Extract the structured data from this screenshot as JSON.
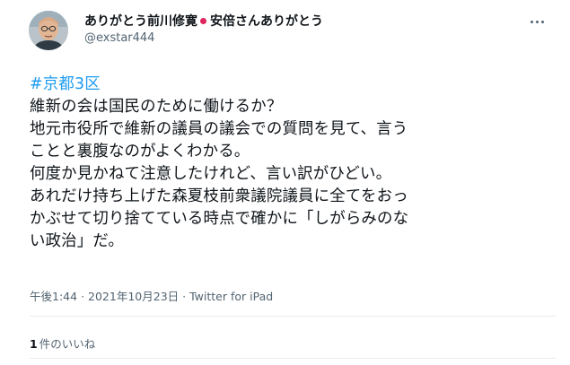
{
  "author": {
    "display_name_part1": "ありがとう前川修寛",
    "display_name_part2": "安倍さんありがとう",
    "handle": "@exstar444"
  },
  "tweet": {
    "hashtag": "#京都3区",
    "lines": [
      "維新の会は国民のために働けるか？",
      "地元市役所で維新の議員の議会での質問を見て、言う",
      "ことと裏腹なのがよくわかる。",
      "何度か見かねて注意したけれど、言い訳がひどい。",
      "あれだけ持ち上げた森夏枝前衆議院議員に全てをおっ",
      "かぶせて切り捨てている時点で確かに「しがらみのな",
      "い政治」だ。"
    ]
  },
  "meta": {
    "time": "午後1:44",
    "separator": "·",
    "date": "2021年10月23日",
    "source": "Twitter for iPad"
  },
  "stats": {
    "like_count": "1",
    "like_label": "件のいいね"
  },
  "colors": {
    "link": "#1d9bf0",
    "secondary_text": "#536471",
    "divider": "#e6ecf0",
    "emoji_dot": "#e0245e"
  },
  "icons": {
    "more": "more-dots-icon",
    "separator_emoji": "red-circle-icon"
  }
}
